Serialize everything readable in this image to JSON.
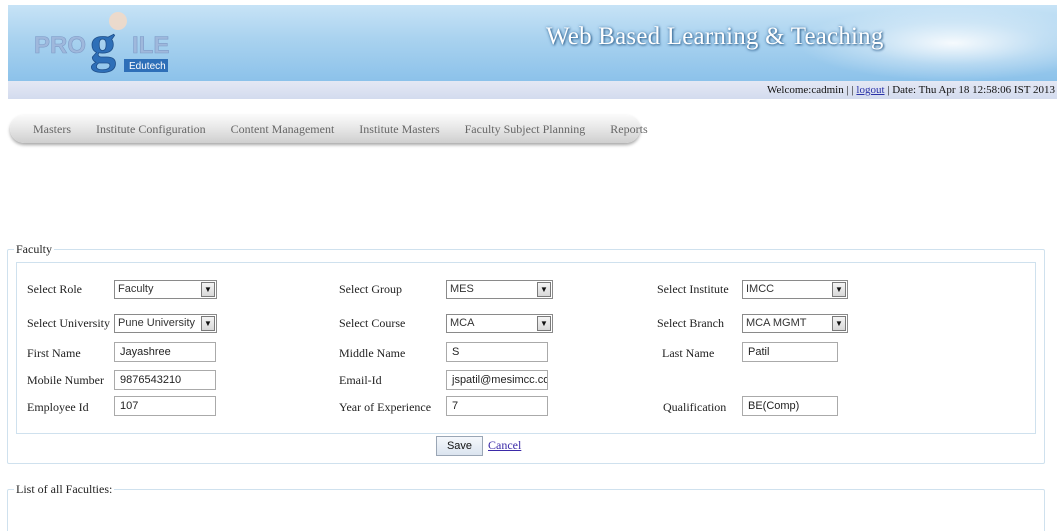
{
  "header": {
    "logo_text": "PROGILE",
    "logo_subtext": "Edutech",
    "title": "Web Based Learning & Teaching"
  },
  "status_bar": {
    "welcome": "Welcome:cadmin | |",
    "logout": "logout",
    "date": "| Date: Thu Apr 18 12:58:06 IST 2013"
  },
  "menu": [
    {
      "label": "Masters"
    },
    {
      "label": "Institute Configuration"
    },
    {
      "label": "Content Management"
    },
    {
      "label": "Institute Masters"
    },
    {
      "label": "Faculty Subject Planning"
    },
    {
      "label": "Reports"
    }
  ],
  "form": {
    "legend": "Faculty",
    "labels": {
      "role": "Select Role",
      "group": "Select Group",
      "institute": "Select Institute",
      "university": "Select University",
      "course": "Select Course",
      "branch": "Select Branch",
      "first_name": "First Name",
      "middle_name": "Middle Name",
      "last_name": "Last Name",
      "mobile": "Mobile Number",
      "email": "Email-Id",
      "employee_id": "Employee Id",
      "experience": "Year of Experience",
      "qualification": "Qualification"
    },
    "values": {
      "role": "Faculty",
      "group": "MES",
      "institute": "IMCC",
      "university": "Pune University",
      "course": "MCA",
      "branch": "MCA MGMT",
      "first_name": "Jayashree",
      "middle_name": "S",
      "last_name": "Patil",
      "mobile": "9876543210",
      "email": "jspatil@mesimcc.com",
      "employee_id": "107",
      "experience": "7",
      "qualification": "BE(Comp)"
    },
    "save_label": "Save",
    "cancel_label": "Cancel"
  },
  "list": {
    "legend": "List of all Faculties:"
  }
}
